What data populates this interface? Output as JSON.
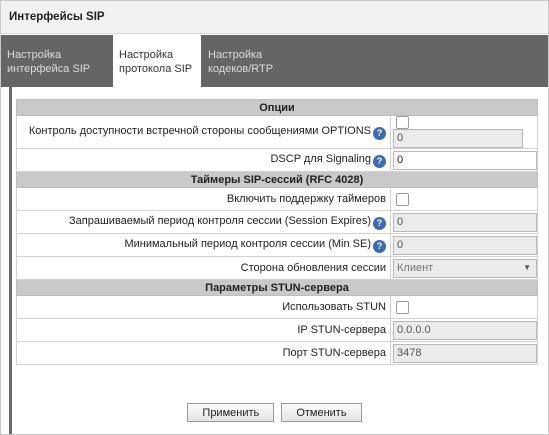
{
  "window": {
    "title": "Интерфейсы SIP"
  },
  "tabs": [
    {
      "label_line1": "Настройка",
      "label_line2": "интерфейса SIP",
      "active": false
    },
    {
      "label_line1": "Настройка",
      "label_line2": "протокола SIP",
      "active": true
    },
    {
      "label_line1": "Настройка",
      "label_line2": "кодеков/RTP",
      "active": false
    }
  ],
  "sections": {
    "options": "Опции",
    "timers": "Таймеры SIP-сессий (RFC 4028)",
    "stun": "Параметры STUN-сервера"
  },
  "rows": {
    "options_check": {
      "label": "Контроль доступности встречной стороны сообщениями OPTIONS",
      "checked": false,
      "value": "0"
    },
    "dscp": {
      "label": "DSCP для Signaling",
      "value": "0"
    },
    "enable_timers": {
      "label": "Включить поддержку таймеров",
      "checked": false
    },
    "session_expires": {
      "label": "Запрашиваемый период контроля сессии (Session Expires)",
      "value": "0"
    },
    "min_se": {
      "label": "Минимальный период контроля сессии (Min SE)",
      "value": "0"
    },
    "refresher": {
      "label": "Сторона обновления сессии",
      "selected": "Клиент"
    },
    "use_stun": {
      "label": "Использовать STUN",
      "checked": false
    },
    "stun_ip": {
      "label": "IP STUN-сервера",
      "value": "0.0.0.0"
    },
    "stun_port": {
      "label": "Порт STUN-сервера",
      "value": "3478"
    }
  },
  "icons": {
    "help": "help-icon",
    "dropdown": "chevron-down-icon"
  },
  "buttons": {
    "apply": "Применить",
    "cancel": "Отменить"
  },
  "colors": {
    "tab_bar": "#656565",
    "section_header": "#c9c9c9",
    "help_icon": "#3d6bb3"
  }
}
